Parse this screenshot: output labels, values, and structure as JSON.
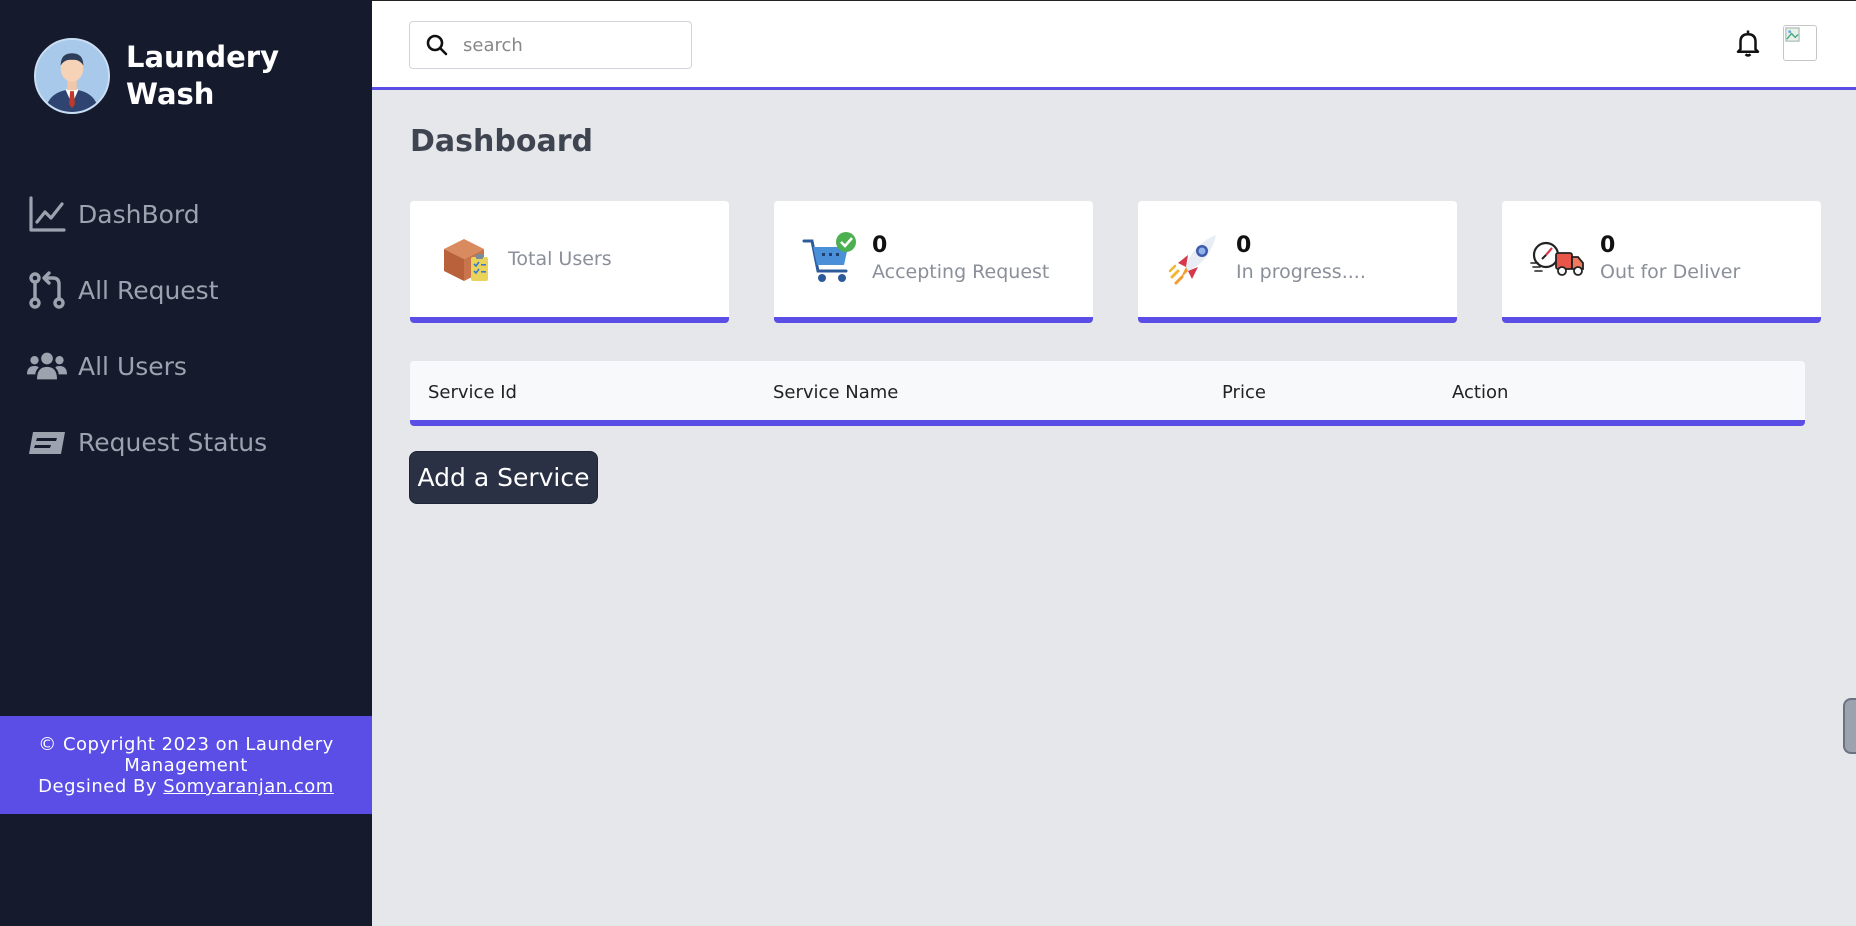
{
  "brand": {
    "name": "Laundery Wash"
  },
  "sidebar": {
    "items": [
      {
        "label": "DashBord",
        "icon": "chart-line-icon"
      },
      {
        "label": "All Request",
        "icon": "code-pull-request-icon"
      },
      {
        "label": "All Users",
        "icon": "users-icon"
      },
      {
        "label": "Request Status",
        "icon": "envelope-stamp-icon"
      }
    ],
    "footer": {
      "copyright": "© Copyright 2023 on Laundery Management",
      "designed_prefix": "Degsined By ",
      "designer_link": "Somyaranjan.com"
    }
  },
  "header": {
    "search_placeholder": "search"
  },
  "main": {
    "title": "Dashboard",
    "cards": [
      {
        "value": "",
        "label": "Total Users",
        "icon": "package-icon"
      },
      {
        "value": "0",
        "label": "Accepting Request",
        "icon": "shopping-cart-check-icon"
      },
      {
        "value": "0",
        "label": "In progress....",
        "icon": "rocket-icon"
      },
      {
        "value": "0",
        "label": "Out for Deliver",
        "icon": "delivery-truck-icon"
      }
    ],
    "table": {
      "columns": [
        "Service Id",
        "Service Name",
        "Price",
        "Action"
      ]
    },
    "add_button": "Add a Service"
  },
  "colors": {
    "sidebar_bg": "#151a2d",
    "accent": "#5b4ee6",
    "page_bg": "#e5e7eb",
    "button_bg": "#2a3144"
  }
}
